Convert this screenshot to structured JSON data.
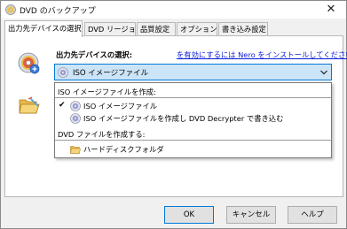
{
  "window": {
    "title": "DVD のバックアップ",
    "close_glyph": "✕"
  },
  "tabs": [
    {
      "label": "出力先デバイスの選択",
      "active": true
    },
    {
      "label": "DVD リージョン",
      "active": false
    },
    {
      "label": "品質設定",
      "active": false
    },
    {
      "label": "オプション",
      "active": false
    },
    {
      "label": "書き込み設定",
      "active": false
    }
  ],
  "destination": {
    "label": "出力先デバイスの選択:",
    "nero_link": "を有効にするには Nero をインストールしてください",
    "selected": "ISO イメージファイル",
    "icons": [
      "disc-icon",
      "dropdown-arrow-icon",
      "folder-icon"
    ]
  },
  "dropdown": {
    "groups": [
      {
        "header": "ISO イメージファイルを作成:",
        "items": [
          {
            "label": "ISO イメージファイル",
            "checked": true,
            "icon": "disc-icon"
          },
          {
            "label": "ISO イメージファイルを作成し DVD Decrypter で書き込む",
            "checked": false,
            "icon": "disc-icon"
          }
        ]
      },
      {
        "header": "DVD ファイルを作成する:",
        "items": [
          {
            "label": "ハードディスクフォルダ",
            "checked": false,
            "icon": "folder-icon"
          }
        ]
      }
    ],
    "check_glyph": "✔"
  },
  "buttons": {
    "ok": "OK",
    "cancel": "キャンセル",
    "help": "ヘルプ"
  }
}
